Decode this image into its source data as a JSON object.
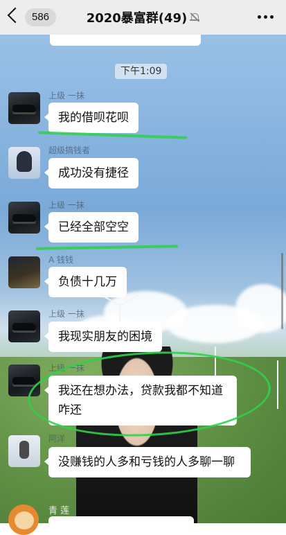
{
  "header": {
    "unread_count": "586",
    "title": "2020暴富群(49)"
  },
  "time_divider": "下午1:09",
  "messages": [
    {
      "sender": "上级 一抹",
      "text": "我的借呗花呗"
    },
    {
      "sender": "超级搞钱者",
      "text": "成功没有捷径"
    },
    {
      "sender": "上级 一抹",
      "text": "已经全部空空"
    },
    {
      "sender": "A 钱钱",
      "text": "负债十几万"
    },
    {
      "sender": "上级 一抹",
      "text": "我现实朋友的困境"
    },
    {
      "sender": "上级 一抹",
      "text": "我还在想办法，贷款我都不知道咋还"
    },
    {
      "sender": "阿洋",
      "text": "没赚钱的人多和亏钱的人多聊一聊"
    },
    {
      "sender": "青 莲",
      "text": ""
    }
  ]
}
